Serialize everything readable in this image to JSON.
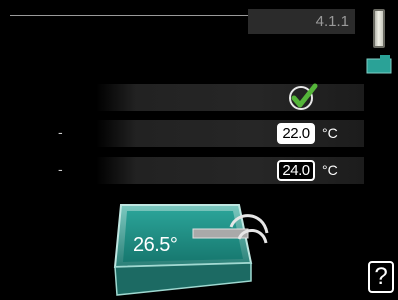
{
  "header": {
    "menu_code": "4.1.1"
  },
  "rows": [
    {
      "name": "activated",
      "value": "",
      "checked": true
    },
    {
      "label": "-",
      "value": "22.0",
      "unit": "°C",
      "selected": true
    },
    {
      "label": "-",
      "value": "24.0",
      "unit": "°C",
      "selected": false
    }
  ],
  "pool": {
    "temperature": "26.5°",
    "water_color": "#1f8f87"
  },
  "help": {
    "label": "?"
  },
  "colors": {
    "accent": "#2aa297",
    "check": "#4caf3a"
  }
}
